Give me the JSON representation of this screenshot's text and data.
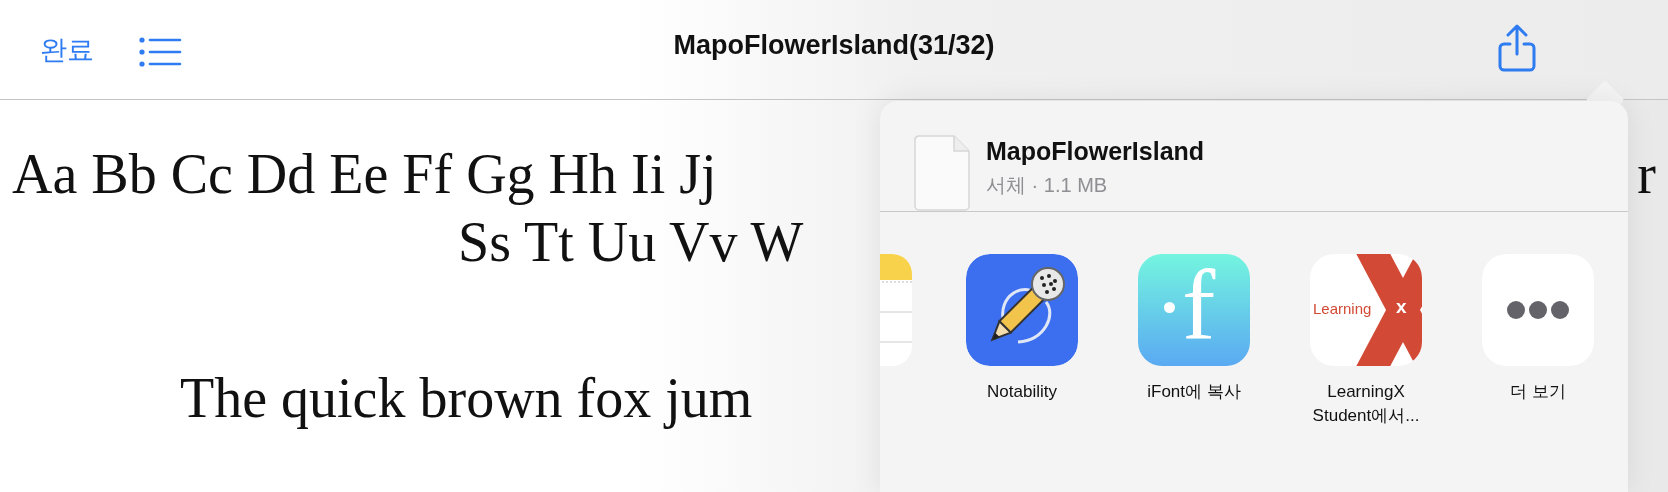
{
  "nav": {
    "done": "완료",
    "title": "MapoFlowerIsland(31/32)"
  },
  "preview": {
    "lines": [
      {
        "kind": "alphabet",
        "text": "Aa Bb Cc Dd Ee Ff Gg Hh Ii Jj",
        "tail": "r"
      },
      {
        "kind": "alphabet2",
        "text": "Ss Tt Uu Vv W"
      },
      {
        "kind": "sentence",
        "text": "The quick brown fox jum"
      }
    ]
  },
  "share_sheet": {
    "file": {
      "name": "MapoFlowerIsland",
      "info": "서체 · 1.1 MB"
    },
    "apps": [
      {
        "kind": "notes"
      },
      {
        "kind": "notability",
        "label": "Notability"
      },
      {
        "kind": "ifont",
        "label": "iFont에 복사",
        "icon_text": "f"
      },
      {
        "kind": "learningx",
        "label": "LearningX Student에서...",
        "icon_text": [
          "Learning",
          "x"
        ]
      },
      {
        "kind": "more",
        "label": "더 보기"
      }
    ]
  }
}
